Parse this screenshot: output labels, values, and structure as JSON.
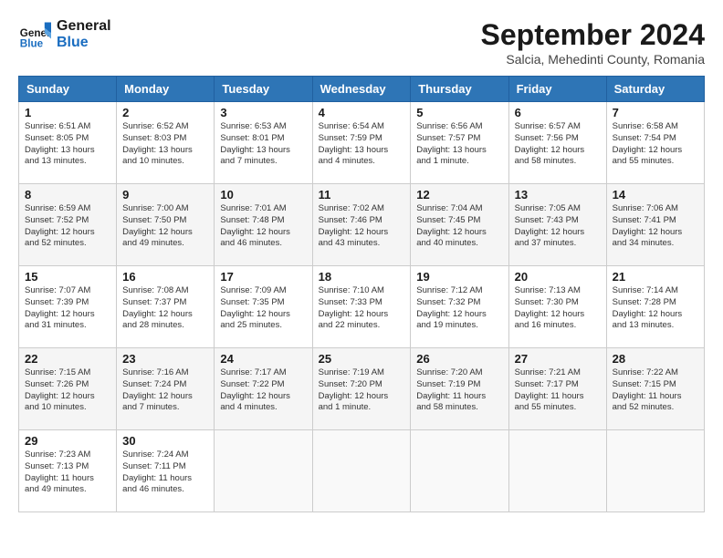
{
  "header": {
    "logo_line1": "General",
    "logo_line2": "Blue",
    "month": "September 2024",
    "location": "Salcia, Mehedinti County, Romania"
  },
  "days_of_week": [
    "Sunday",
    "Monday",
    "Tuesday",
    "Wednesday",
    "Thursday",
    "Friday",
    "Saturday"
  ],
  "weeks": [
    [
      {
        "day": 1,
        "info": "Sunrise: 6:51 AM\nSunset: 8:05 PM\nDaylight: 13 hours\nand 13 minutes."
      },
      {
        "day": 2,
        "info": "Sunrise: 6:52 AM\nSunset: 8:03 PM\nDaylight: 13 hours\nand 10 minutes."
      },
      {
        "day": 3,
        "info": "Sunrise: 6:53 AM\nSunset: 8:01 PM\nDaylight: 13 hours\nand 7 minutes."
      },
      {
        "day": 4,
        "info": "Sunrise: 6:54 AM\nSunset: 7:59 PM\nDaylight: 13 hours\nand 4 minutes."
      },
      {
        "day": 5,
        "info": "Sunrise: 6:56 AM\nSunset: 7:57 PM\nDaylight: 13 hours\nand 1 minute."
      },
      {
        "day": 6,
        "info": "Sunrise: 6:57 AM\nSunset: 7:56 PM\nDaylight: 12 hours\nand 58 minutes."
      },
      {
        "day": 7,
        "info": "Sunrise: 6:58 AM\nSunset: 7:54 PM\nDaylight: 12 hours\nand 55 minutes."
      }
    ],
    [
      {
        "day": 8,
        "info": "Sunrise: 6:59 AM\nSunset: 7:52 PM\nDaylight: 12 hours\nand 52 minutes."
      },
      {
        "day": 9,
        "info": "Sunrise: 7:00 AM\nSunset: 7:50 PM\nDaylight: 12 hours\nand 49 minutes."
      },
      {
        "day": 10,
        "info": "Sunrise: 7:01 AM\nSunset: 7:48 PM\nDaylight: 12 hours\nand 46 minutes."
      },
      {
        "day": 11,
        "info": "Sunrise: 7:02 AM\nSunset: 7:46 PM\nDaylight: 12 hours\nand 43 minutes."
      },
      {
        "day": 12,
        "info": "Sunrise: 7:04 AM\nSunset: 7:45 PM\nDaylight: 12 hours\nand 40 minutes."
      },
      {
        "day": 13,
        "info": "Sunrise: 7:05 AM\nSunset: 7:43 PM\nDaylight: 12 hours\nand 37 minutes."
      },
      {
        "day": 14,
        "info": "Sunrise: 7:06 AM\nSunset: 7:41 PM\nDaylight: 12 hours\nand 34 minutes."
      }
    ],
    [
      {
        "day": 15,
        "info": "Sunrise: 7:07 AM\nSunset: 7:39 PM\nDaylight: 12 hours\nand 31 minutes."
      },
      {
        "day": 16,
        "info": "Sunrise: 7:08 AM\nSunset: 7:37 PM\nDaylight: 12 hours\nand 28 minutes."
      },
      {
        "day": 17,
        "info": "Sunrise: 7:09 AM\nSunset: 7:35 PM\nDaylight: 12 hours\nand 25 minutes."
      },
      {
        "day": 18,
        "info": "Sunrise: 7:10 AM\nSunset: 7:33 PM\nDaylight: 12 hours\nand 22 minutes."
      },
      {
        "day": 19,
        "info": "Sunrise: 7:12 AM\nSunset: 7:32 PM\nDaylight: 12 hours\nand 19 minutes."
      },
      {
        "day": 20,
        "info": "Sunrise: 7:13 AM\nSunset: 7:30 PM\nDaylight: 12 hours\nand 16 minutes."
      },
      {
        "day": 21,
        "info": "Sunrise: 7:14 AM\nSunset: 7:28 PM\nDaylight: 12 hours\nand 13 minutes."
      }
    ],
    [
      {
        "day": 22,
        "info": "Sunrise: 7:15 AM\nSunset: 7:26 PM\nDaylight: 12 hours\nand 10 minutes."
      },
      {
        "day": 23,
        "info": "Sunrise: 7:16 AM\nSunset: 7:24 PM\nDaylight: 12 hours\nand 7 minutes."
      },
      {
        "day": 24,
        "info": "Sunrise: 7:17 AM\nSunset: 7:22 PM\nDaylight: 12 hours\nand 4 minutes."
      },
      {
        "day": 25,
        "info": "Sunrise: 7:19 AM\nSunset: 7:20 PM\nDaylight: 12 hours\nand 1 minute."
      },
      {
        "day": 26,
        "info": "Sunrise: 7:20 AM\nSunset: 7:19 PM\nDaylight: 11 hours\nand 58 minutes."
      },
      {
        "day": 27,
        "info": "Sunrise: 7:21 AM\nSunset: 7:17 PM\nDaylight: 11 hours\nand 55 minutes."
      },
      {
        "day": 28,
        "info": "Sunrise: 7:22 AM\nSunset: 7:15 PM\nDaylight: 11 hours\nand 52 minutes."
      }
    ],
    [
      {
        "day": 29,
        "info": "Sunrise: 7:23 AM\nSunset: 7:13 PM\nDaylight: 11 hours\nand 49 minutes."
      },
      {
        "day": 30,
        "info": "Sunrise: 7:24 AM\nSunset: 7:11 PM\nDaylight: 11 hours\nand 46 minutes."
      },
      {
        "day": null,
        "info": ""
      },
      {
        "day": null,
        "info": ""
      },
      {
        "day": null,
        "info": ""
      },
      {
        "day": null,
        "info": ""
      },
      {
        "day": null,
        "info": ""
      }
    ]
  ]
}
